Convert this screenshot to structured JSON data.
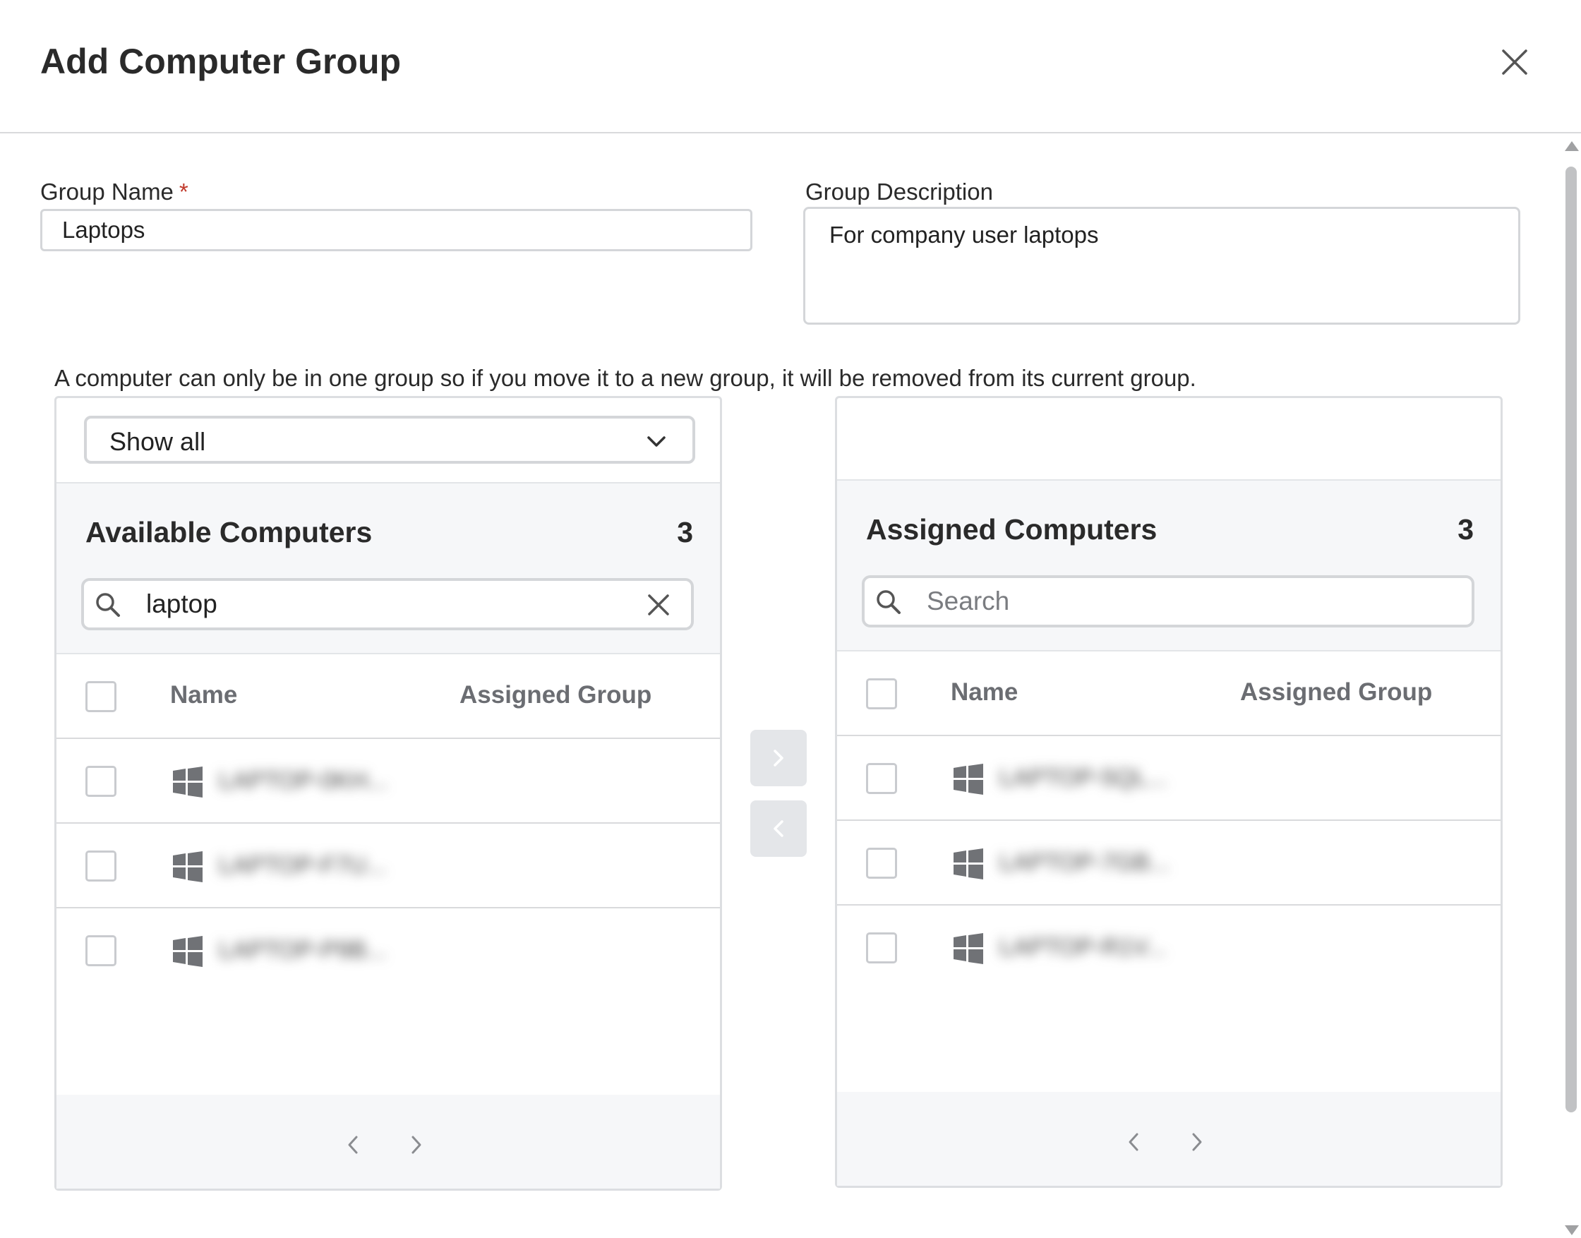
{
  "modal": {
    "title": "Add Computer Group"
  },
  "form": {
    "group_name_label": "Group Name",
    "required_mark": "*",
    "group_name_value": "Laptops",
    "group_description_label": "Group Description",
    "group_description_value": "For company user laptops"
  },
  "notice": "A computer can only be in one group so if you move it to a new group, it will be removed from its current group.",
  "available": {
    "filter_value": "Show all",
    "title": "Available Computers",
    "count": "3",
    "search_value": "laptop",
    "columns": [
      "Name",
      "Assigned Group"
    ],
    "rows": [
      {
        "name": "LAPTOP-0KH...",
        "icon": "windows-icon"
      },
      {
        "name": "LAPTOP-F7U...",
        "icon": "windows-icon"
      },
      {
        "name": "LAPTOP-P9B...",
        "icon": "windows-icon"
      }
    ]
  },
  "assigned": {
    "title": "Assigned Computers",
    "count": "3",
    "search_placeholder": "Search",
    "columns": [
      "Name",
      "Assigned Group"
    ],
    "rows": [
      {
        "name": "LAPTOP-5QL...",
        "icon": "windows-icon"
      },
      {
        "name": "LAPTOP-7GB...",
        "icon": "windows-icon"
      },
      {
        "name": "LAPTOP-R1V...",
        "icon": "windows-icon"
      }
    ]
  },
  "colors": {
    "panel_background": "#f6f7f9",
    "border": "#d4d6d9",
    "icon_gray": "#707276",
    "required": "#c0392b",
    "move_button": "#e4e6e9"
  }
}
